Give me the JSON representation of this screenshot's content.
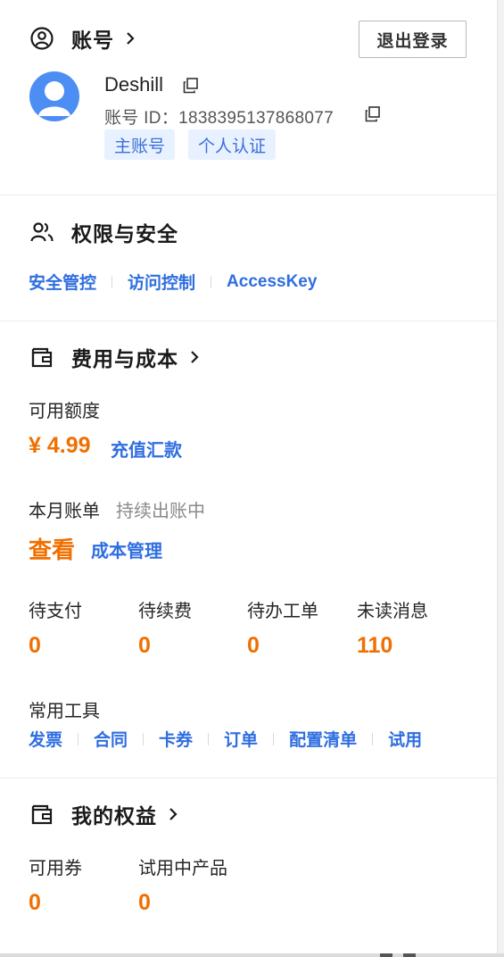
{
  "account": {
    "title": "账号",
    "logout_label": "退出登录",
    "username": "Deshill",
    "account_id": "账号 ID：1838395137868077",
    "tags": [
      "主账号",
      "个人认证"
    ]
  },
  "permissions": {
    "title": "权限与安全",
    "links": [
      "安全管控",
      "访问控制",
      "AccessKey"
    ]
  },
  "billing": {
    "title": "费用与成本",
    "available_label": "可用额度",
    "available_amount": "¥ 4.99",
    "recharge_label": "充值汇款",
    "monthly_bill_label": "本月账单",
    "monthly_bill_status": "持续出账中",
    "view_label": "查看",
    "cost_manage_label": "成本管理",
    "stats": [
      {
        "label": "待支付",
        "value": "0"
      },
      {
        "label": "待续费",
        "value": "0"
      },
      {
        "label": "待办工单",
        "value": "0"
      },
      {
        "label": "未读消息",
        "value": "110"
      }
    ],
    "tools_label": "常用工具",
    "tools": [
      "发票",
      "合同",
      "卡券",
      "订单",
      "配置清单",
      "试用"
    ]
  },
  "benefits": {
    "title": "我的权益",
    "stats": [
      {
        "label": "可用券",
        "value": "0"
      },
      {
        "label": "试用中产品",
        "value": "0"
      }
    ]
  },
  "colors": {
    "accent_blue": "#2f6ee0",
    "accent_orange": "#f06f00",
    "avatar_blue": "#4d8ef5",
    "tag_bg": "#e8f1ff"
  },
  "icons": {
    "account": "user-circle-icon",
    "permissions": "users-icon",
    "billing": "wallet-icon",
    "benefits": "wallet-icon",
    "copy": "copy-icon",
    "chevron": "chevron-right-icon"
  }
}
